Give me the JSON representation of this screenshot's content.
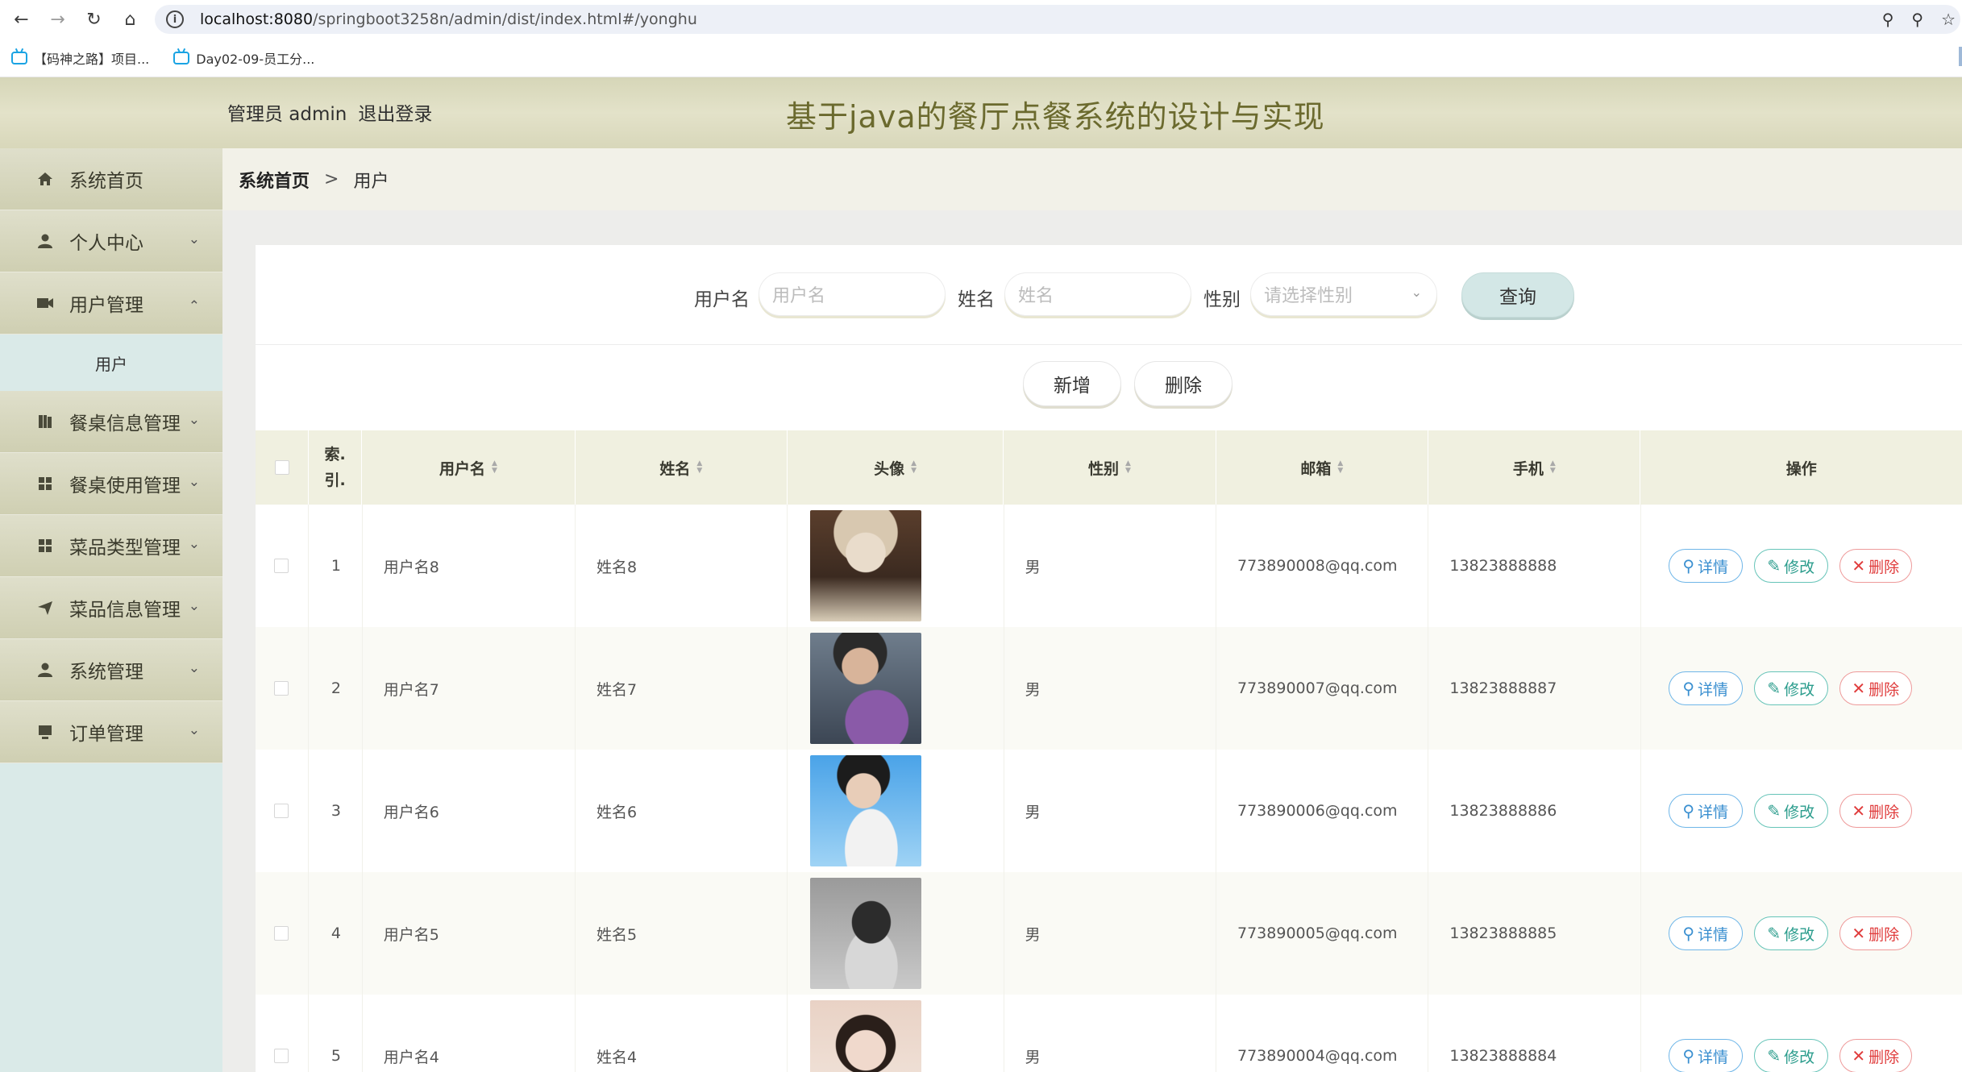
{
  "browser": {
    "url_host": "localhost:8080",
    "url_path": "/springboot3258n/admin/dist/index.html#/yonghu",
    "bookmarks": [
      "【码神之路】项目...",
      "Day02-09-员工分..."
    ]
  },
  "header": {
    "user_role": "管理员 admin",
    "logout_label": "退出登录",
    "title": "基于java的餐厅点餐系统的设计与实现"
  },
  "sidebar": {
    "items": [
      {
        "label": "系统首页",
        "icon": "home-icon"
      },
      {
        "label": "个人中心",
        "icon": "person-icon"
      },
      {
        "label": "用户管理",
        "icon": "user-manage-icon"
      },
      {
        "label": "餐桌信息管理",
        "icon": "book-icon"
      },
      {
        "label": "餐桌使用管理",
        "icon": "grid-icon"
      },
      {
        "label": "菜品类型管理",
        "icon": "grid-icon"
      },
      {
        "label": "菜品信息管理",
        "icon": "send-icon"
      },
      {
        "label": "系统管理",
        "icon": "person-icon"
      },
      {
        "label": "订单管理",
        "icon": "monitor-icon"
      }
    ],
    "submenu_label": "用户"
  },
  "breadcrumb": {
    "home": "系统首页",
    "separator": ">",
    "current": "用户"
  },
  "search": {
    "username_label": "用户名",
    "username_placeholder": "用户名",
    "name_label": "姓名",
    "name_placeholder": "姓名",
    "gender_label": "性别",
    "gender_placeholder": "请选择性别",
    "query_label": "查询"
  },
  "actions": {
    "add_label": "新增",
    "delete_label": "删除"
  },
  "table": {
    "columns": [
      "索引",
      "用户名",
      "姓名",
      "头像",
      "性别",
      "邮箱",
      "手机",
      "操作"
    ],
    "index_col_line1": "索.",
    "index_col_line2": "引.",
    "op_detail": "详情",
    "op_edit": "修改",
    "op_delete": "删除",
    "rows": [
      {
        "index": "1",
        "username": "用户名8",
        "name": "姓名8",
        "gender": "男",
        "email": "773890008@qq.com",
        "phone": "13823888888"
      },
      {
        "index": "2",
        "username": "用户名7",
        "name": "姓名7",
        "gender": "男",
        "email": "773890007@qq.com",
        "phone": "13823888887"
      },
      {
        "index": "3",
        "username": "用户名6",
        "name": "姓名6",
        "gender": "男",
        "email": "773890006@qq.com",
        "phone": "13823888886"
      },
      {
        "index": "4",
        "username": "用户名5",
        "name": "姓名5",
        "gender": "男",
        "email": "773890005@qq.com",
        "phone": "13823888885"
      },
      {
        "index": "5",
        "username": "用户名4",
        "name": "姓名4",
        "gender": "男",
        "email": "773890004@qq.com",
        "phone": "13823888884"
      }
    ]
  }
}
